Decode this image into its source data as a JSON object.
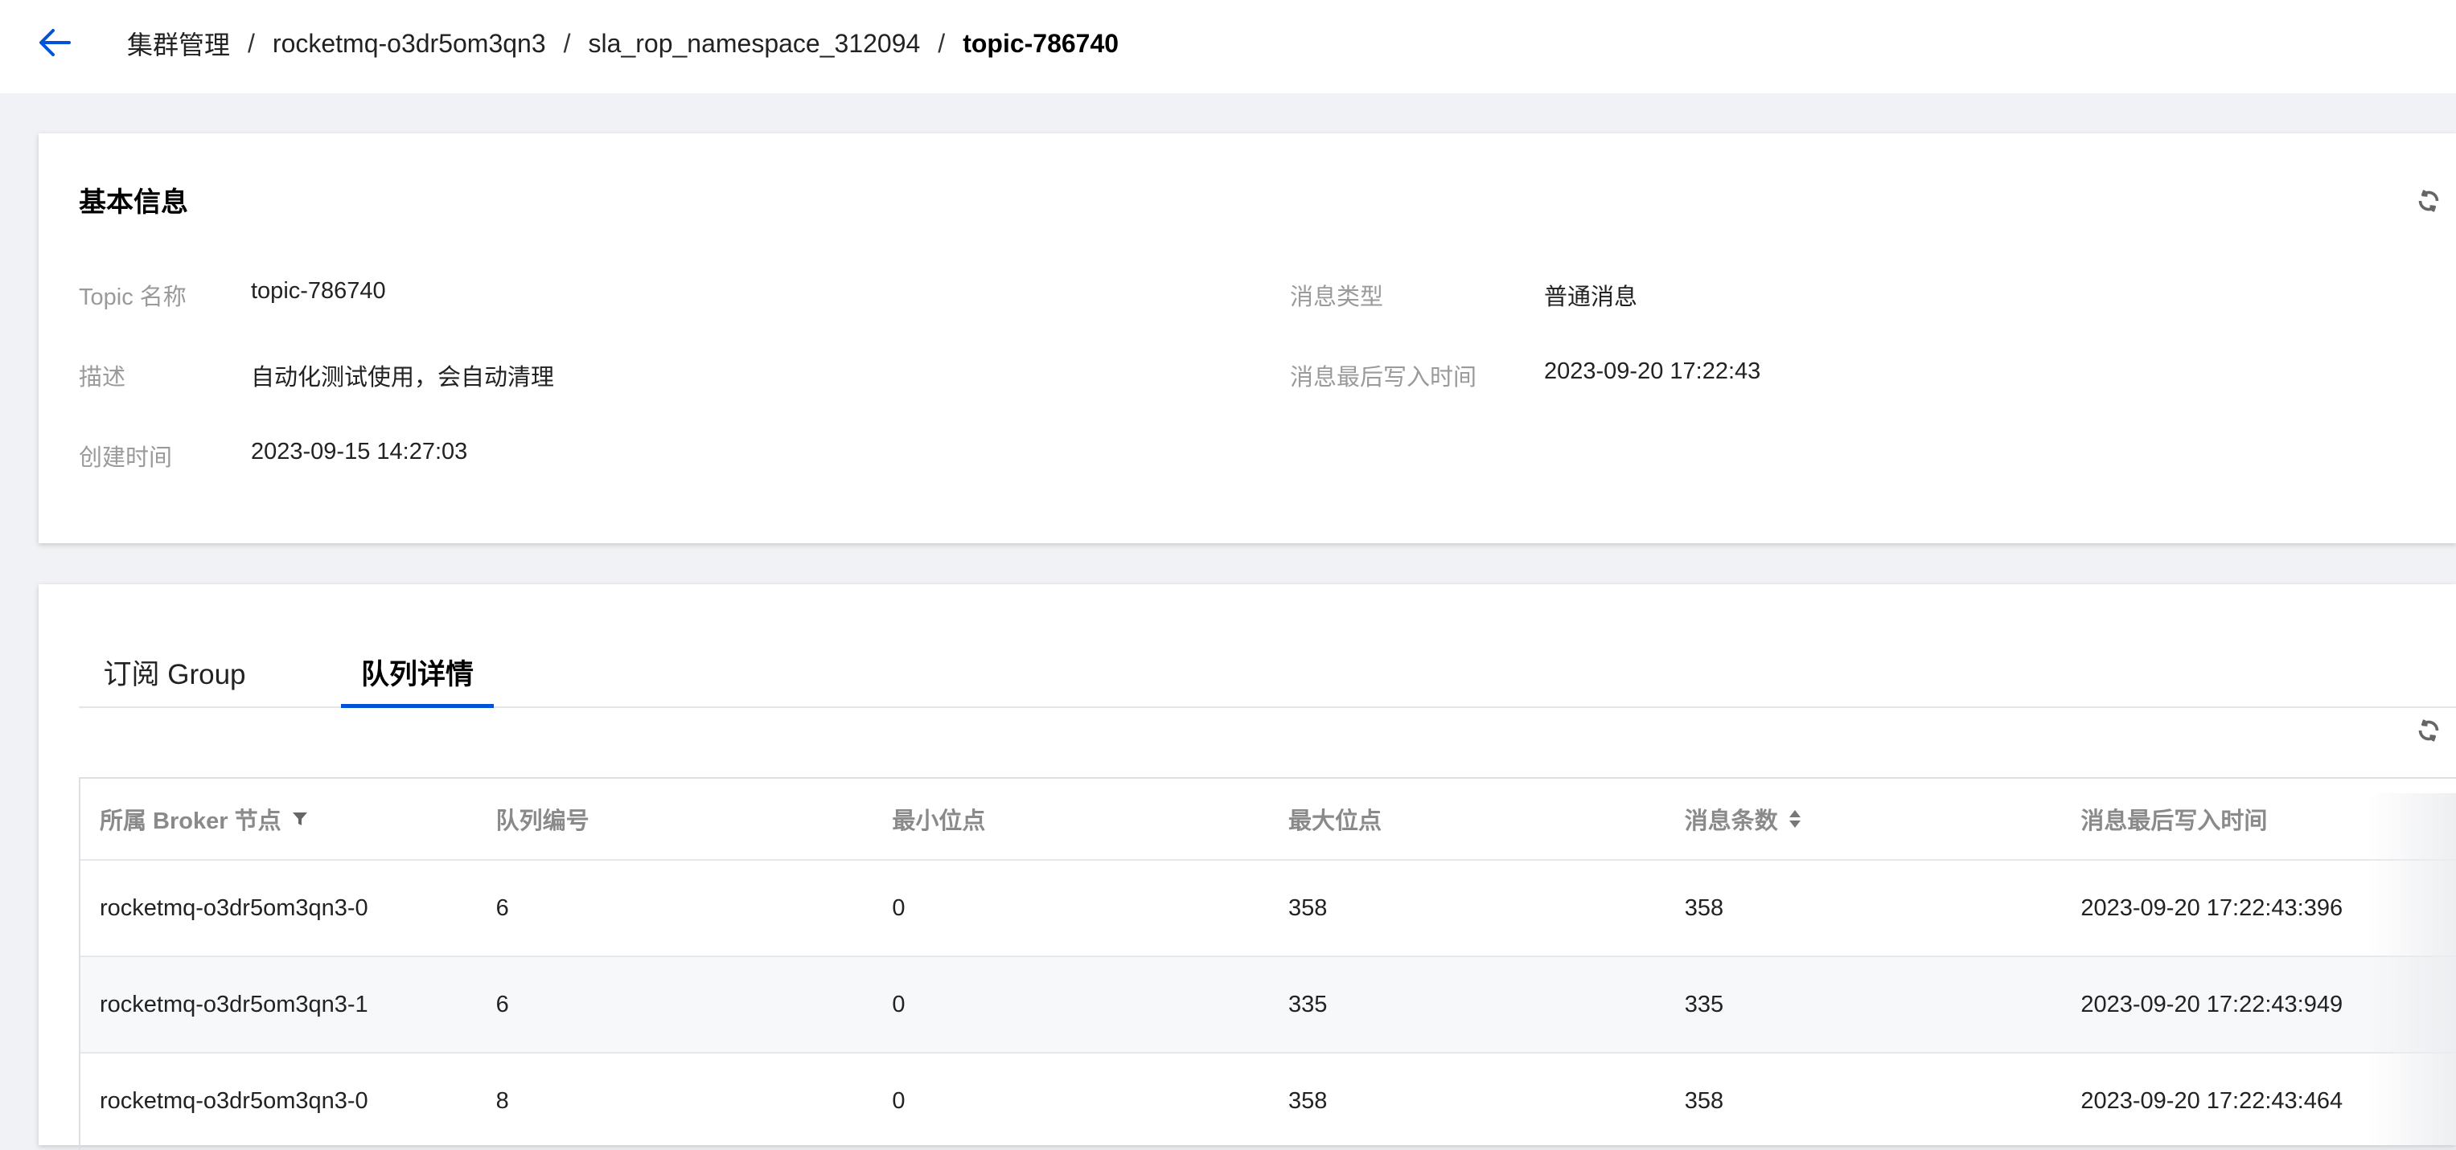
{
  "breadcrumb": {
    "items": [
      "集群管理",
      "rocketmq-o3dr5om3qn3",
      "sla_rop_namespace_312094"
    ],
    "current": "topic-786740",
    "separator": "/"
  },
  "basic_info": {
    "title": "基本信息",
    "topic_name": {
      "label": "Topic 名称",
      "value": "topic-786740"
    },
    "description": {
      "label": "描述",
      "value": "自动化测试使用，会自动清理"
    },
    "created_time": {
      "label": "创建时间",
      "value": "2023-09-15 14:27:03"
    },
    "message_type": {
      "label": "消息类型",
      "value": "普通消息"
    },
    "last_write_time": {
      "label": "消息最后写入时间",
      "value": "2023-09-20 17:22:43"
    }
  },
  "tabs": [
    {
      "label": "订阅 Group",
      "active": false
    },
    {
      "label": "队列详情",
      "active": true
    }
  ],
  "queue_table": {
    "columns": [
      "所属 Broker 节点",
      "队列编号",
      "最小位点",
      "最大位点",
      "消息条数",
      "消息最后写入时间"
    ],
    "rows": [
      [
        "rocketmq-o3dr5om3qn3-0",
        "6",
        "0",
        "358",
        "358",
        "2023-09-20 17:22:43:396"
      ],
      [
        "rocketmq-o3dr5om3qn3-1",
        "6",
        "0",
        "335",
        "335",
        "2023-09-20 17:22:43:949"
      ],
      [
        "rocketmq-o3dr5om3qn3-0",
        "8",
        "0",
        "358",
        "358",
        "2023-09-20 17:22:43:464"
      ]
    ]
  },
  "icons": {
    "back": "arrow-left-icon",
    "refresh": "refresh-icon",
    "filter": "filter-icon",
    "sort": "sort-icon"
  },
  "colors": {
    "accent": "#0052d9",
    "background": "#f1f2f5",
    "label": "#9a9a9a"
  }
}
